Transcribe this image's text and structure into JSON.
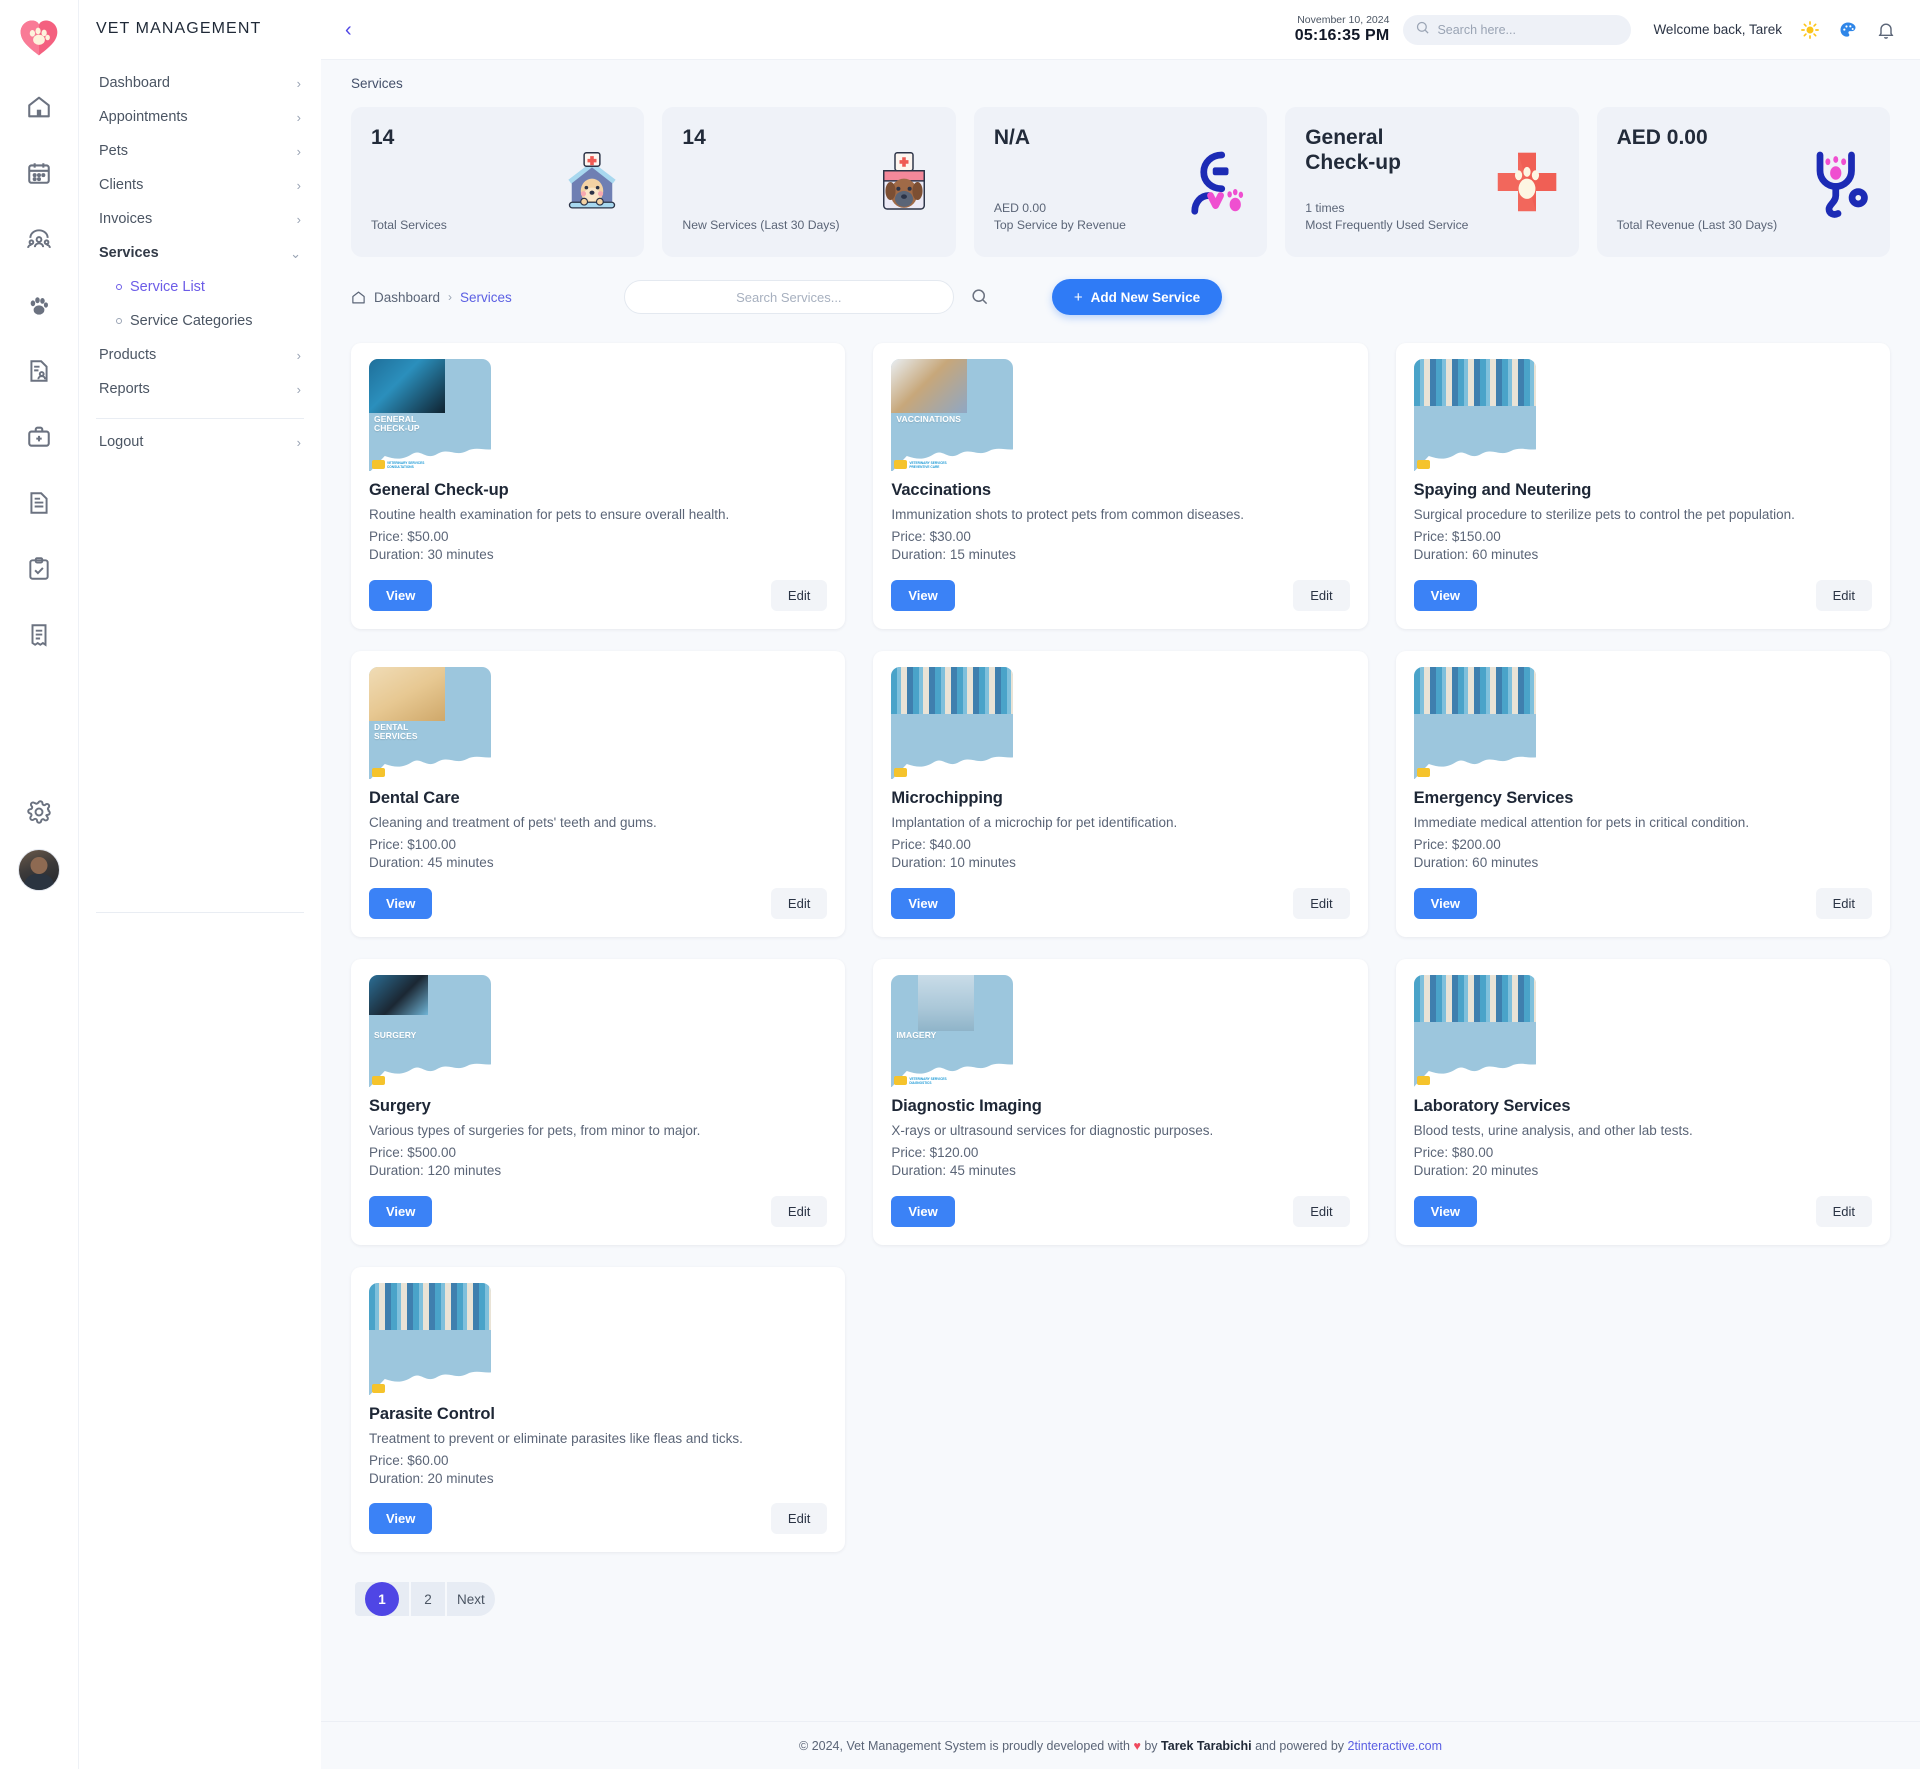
{
  "brand": {
    "logo_icon": "paw-heart-logo",
    "title": "VET MANAGEMENT"
  },
  "rail": {
    "icons": [
      "home-icon",
      "calendar-icon",
      "people-pets-icon",
      "paw-icon",
      "client-record-icon",
      "medical-kit-icon",
      "document-icon",
      "clipboard-check-icon",
      "invoice-icon"
    ],
    "settings_icon": "gear-icon",
    "avatar": "user-avatar"
  },
  "sidebar": {
    "items": [
      {
        "label": "Dashboard",
        "chevron": "›",
        "active": false
      },
      {
        "label": "Appointments",
        "chevron": "›",
        "active": false
      },
      {
        "label": "Pets",
        "chevron": "›",
        "active": false
      },
      {
        "label": "Clients",
        "chevron": "›",
        "active": false
      },
      {
        "label": "Invoices",
        "chevron": "›",
        "active": false
      },
      {
        "label": "Services",
        "chevron": "⌄",
        "active": true
      }
    ],
    "submenu": [
      {
        "label": "Service List",
        "current": true
      },
      {
        "label": "Service Categories",
        "current": false
      }
    ],
    "items_after": [
      {
        "label": "Products",
        "chevron": "›"
      },
      {
        "label": "Reports",
        "chevron": "›"
      }
    ],
    "logout": {
      "label": "Logout",
      "chevron": "›"
    }
  },
  "topbar": {
    "collapse_icon": "chevron-left-icon",
    "date": "November 10, 2024",
    "time": "05:16:35 PM",
    "search_placeholder": "Search here...",
    "search_value": "",
    "search_icon": "search-icon",
    "welcome": "Welcome back, Tarek",
    "icons": [
      "sun-icon",
      "palette-icon",
      "bell-icon"
    ]
  },
  "page": {
    "title": "Services"
  },
  "stats": [
    {
      "value": "14",
      "sub_line1": "",
      "sub_line2": "Total Services",
      "art": "dog-house-icon"
    },
    {
      "value": "14",
      "sub_line1": "",
      "sub_line2": "New Services (Last 30 Days)",
      "art": "dog-nurse-icon"
    },
    {
      "value": "N/A",
      "sub_line1": "AED 0.00",
      "sub_line2": "Top Service by Revenue",
      "art": "vet-logo-icon"
    },
    {
      "value": "General Check-up",
      "sub_line1": "1 times",
      "sub_line2": "Most Frequently Used Service",
      "art": "paw-cross-icon"
    },
    {
      "value": "AED 0.00",
      "sub_line1": "",
      "sub_line2": "Total Revenue (Last 30 Days)",
      "art": "stethoscope-paw-icon"
    }
  ],
  "toolbar": {
    "breadcrumb": {
      "home_icon": "home-icon",
      "root": "Dashboard",
      "separator": "›",
      "current": "Services"
    },
    "search_placeholder": "Search Services...",
    "search_value": "",
    "search_icon": "search-icon",
    "add_button": {
      "plus": "+",
      "label": "Add New Service"
    }
  },
  "card_labels": {
    "view": "View",
    "edit": "Edit"
  },
  "services": [
    {
      "title": "General Check-up",
      "description": "Routine health examination for pets to ensure overall health.",
      "price": "Price: $50.00",
      "duration": "Duration: 30 minutes",
      "thumb_caption": "GENERAL\nCHECK-UP",
      "thumb_logo_text": "VETERINARY SERVICES\nCONSULTATIONS",
      "thumb_photo": "vet-holding-black-dog"
    },
    {
      "title": "Vaccinations",
      "description": "Immunization shots to protect pets from common diseases.",
      "price": "Price: $30.00",
      "duration": "Duration: 15 minutes",
      "thumb_caption": "VACCINATIONS",
      "thumb_logo_text": "VETERINARY SERVICES\nPREVENTIVE CARE",
      "thumb_photo": "pug-getting-vaccine"
    },
    {
      "title": "Spaying and Neutering",
      "description": "Surgical procedure to sterilize pets to control the pet population.",
      "price": "Price: $150.00",
      "duration": "Duration: 60 minutes",
      "thumb_caption": "",
      "thumb_logo_text": "",
      "thumb_photo": "vet-team-with-pets"
    },
    {
      "title": "Dental Care",
      "description": "Cleaning and treatment of pets' teeth and gums.",
      "price": "Price: $100.00",
      "duration": "Duration: 45 minutes",
      "thumb_caption": "DENTAL\nSERVICES",
      "thumb_logo_text": "",
      "thumb_photo": "golden-retriever-teeth"
    },
    {
      "title": "Microchipping",
      "description": "Implantation of a microchip for pet identification.",
      "price": "Price: $40.00",
      "duration": "Duration: 10 minutes",
      "thumb_caption": "",
      "thumb_logo_text": "",
      "thumb_photo": "vet-team-with-pets"
    },
    {
      "title": "Emergency Services",
      "description": "Immediate medical attention for pets in critical condition.",
      "price": "Price: $200.00",
      "duration": "Duration: 60 minutes",
      "thumb_caption": "",
      "thumb_logo_text": "",
      "thumb_photo": "vet-team-with-pets"
    },
    {
      "title": "Surgery",
      "description": "Various types of surgeries for pets, from minor to major.",
      "price": "Price: $500.00",
      "duration": "Duration: 120 minutes",
      "thumb_caption": "SURGERY",
      "thumb_logo_text": "",
      "thumb_photo": "surgeon-with-dog"
    },
    {
      "title": "Diagnostic Imaging",
      "description": "X-rays or ultrasound services for diagnostic purposes.",
      "price": "Price: $120.00",
      "duration": "Duration: 45 minutes",
      "thumb_caption": "IMAGERY",
      "thumb_logo_text": "VETERINARY SERVICES\nDIAGNOSTICS",
      "thumb_photo": "xray-machine"
    },
    {
      "title": "Laboratory Services",
      "description": "Blood tests, urine analysis, and other lab tests.",
      "price": "Price: $80.00",
      "duration": "Duration: 20 minutes",
      "thumb_caption": "",
      "thumb_logo_text": "",
      "thumb_photo": "vet-team-with-pets"
    },
    {
      "title": "Parasite Control",
      "description": "Treatment to prevent or eliminate parasites like fleas and ticks.",
      "price": "Price: $60.00",
      "duration": "Duration: 20 minutes",
      "thumb_caption": "",
      "thumb_logo_text": "",
      "thumb_photo": "vet-team-with-pets"
    }
  ],
  "pagination": {
    "pages": [
      "1",
      "2"
    ],
    "next": "Next",
    "active_index": 0
  },
  "footer": {
    "prefix": "© 2024, Vet Management System is proudly developed with",
    "heart": "♥",
    "by": "by",
    "author": "Tarek Tarabichi",
    "middle": "and powered by",
    "link": "2tinteractive.com"
  },
  "colors": {
    "accent_blue": "#3b82f6",
    "accent_indigo": "#4f46e5",
    "link": "#5b5fe3",
    "bg": "#f7f9fc",
    "stat_bg": "#eff2f8",
    "thumb_bg": "#9cc6dd"
  }
}
